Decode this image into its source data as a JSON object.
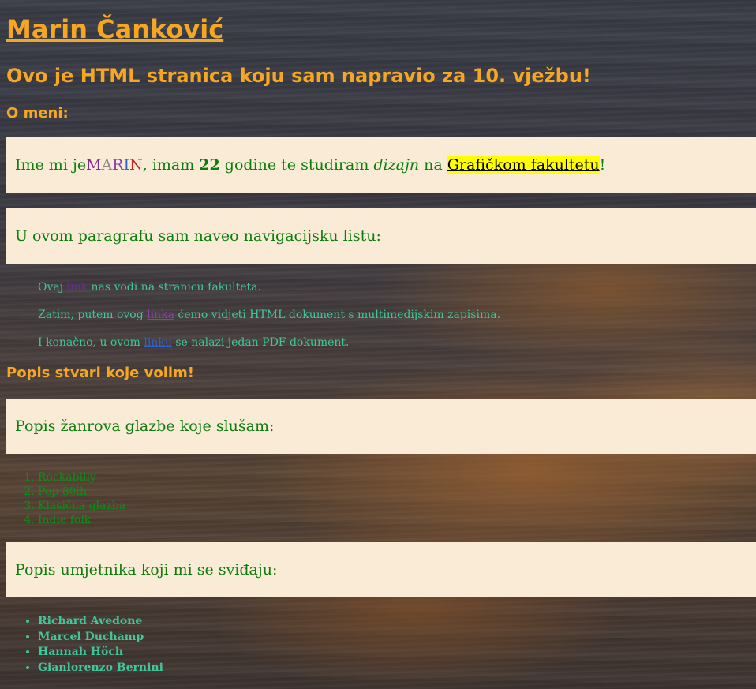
{
  "header": {
    "name": "Marin Čanković",
    "subtitle": "Ovo je HTML stranica koju sam napravio za 10. vježbu!"
  },
  "about": {
    "heading": "O meni:",
    "p1": {
      "t1": "Ime mi je ",
      "marin": [
        "M",
        "A",
        "R",
        "I",
        "N"
      ],
      "t2": ", imam ",
      "age": "22",
      "t3": " godine te studiram ",
      "field": "dizajn",
      "t4": " na ",
      "uni": "Grafičkom fakultetu",
      "t5": "!"
    },
    "p2": "U ovom paragrafu sam naveo navigacijsku listu:"
  },
  "nav": [
    {
      "before": "Ovaj ",
      "link": "link",
      "after": " nas vodi na stranicu fakulteta."
    },
    {
      "before": "Zatim, putem ovog ",
      "link": "linka",
      "after": " ćemo vidjeti HTML dokument s multimedijskim zapisima."
    },
    {
      "before": "I konačno, u ovom ",
      "link": "linku",
      "after": " se nalazi jedan PDF dokument."
    }
  ],
  "likes": {
    "heading": "Popis stvari koje volim!",
    "genres_title": "Popis žanrova glazbe koje slušam:",
    "genres": [
      "Rockabilly",
      "Pop 80ih",
      "Klasična glazba",
      "Indie folk"
    ],
    "artists_title": "Popis umjetnika koji mi se sviđaju:",
    "artists": [
      "Richard Avedone",
      "Marcel Duchamp",
      "Hannah Höch",
      "Gianlorenzo Bernini"
    ]
  },
  "colors": {
    "heading": "#f5a623",
    "box_bg": "#faebd7",
    "box_text": "#0e7d0e",
    "highlight": "#ffff00",
    "marin_letters": [
      "#7a2f8f",
      "#8a8a8a",
      "#8a3fae",
      "#2f62c9",
      "#d62020"
    ]
  }
}
